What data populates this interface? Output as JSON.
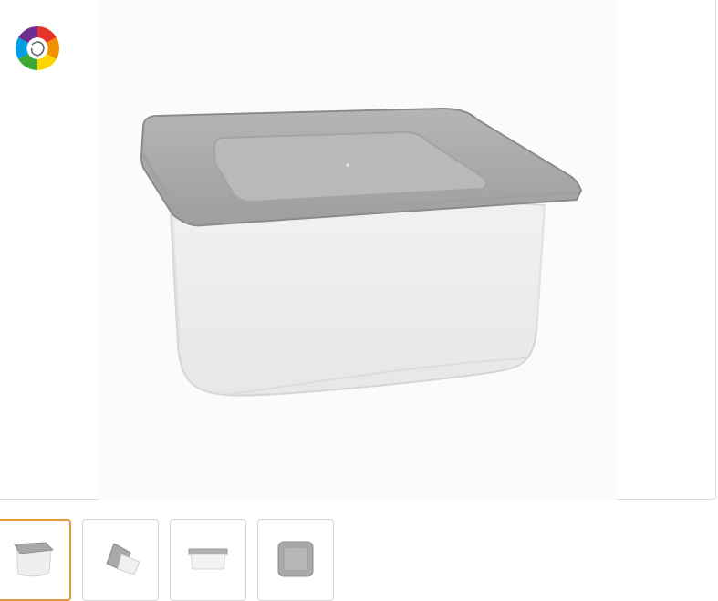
{
  "product_gallery": {
    "brand_logo": {
      "icon": "rainbow-spiral-icon"
    },
    "main_image": {
      "subject": "square-plastic-food-container-icon"
    },
    "thumbnails": [
      {
        "icon": "container-angled-icon",
        "selected": true
      },
      {
        "icon": "container-tilted-icon",
        "selected": false
      },
      {
        "icon": "container-side-icon",
        "selected": false
      },
      {
        "icon": "container-top-icon",
        "selected": false
      }
    ],
    "colors": {
      "lid": "#a9a9a9",
      "lid_dark": "#8f8f8f",
      "body": "#eeeeee",
      "selected_border": "#e39a3b",
      "border": "#d8d8d8"
    }
  }
}
